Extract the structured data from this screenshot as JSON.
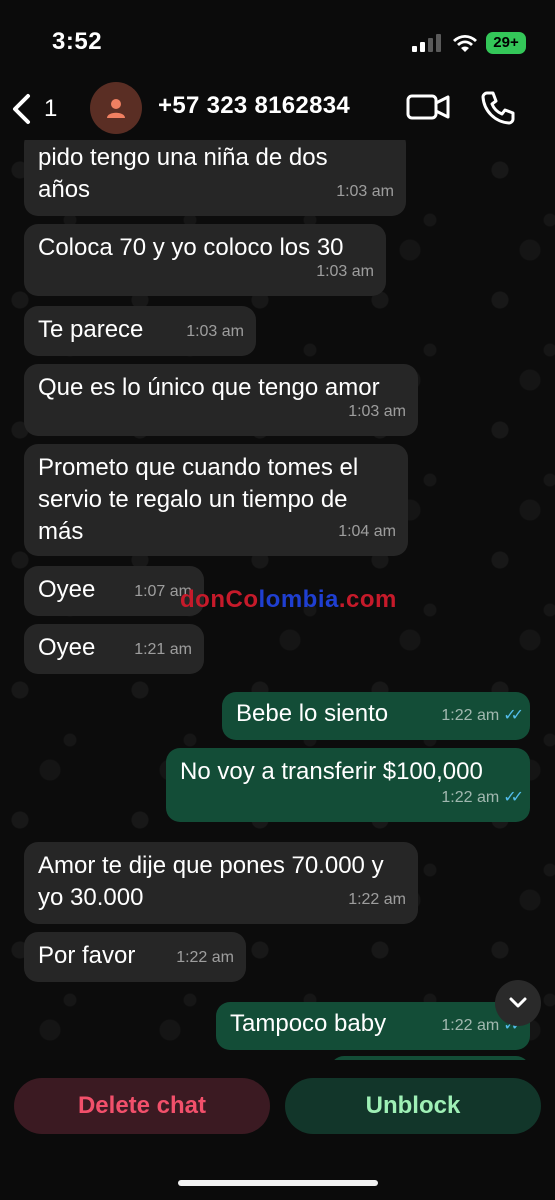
{
  "status_bar": {
    "time": "3:52",
    "battery": "29+"
  },
  "header": {
    "back_count": "1",
    "contact": "+57 323 8162834"
  },
  "messages": [
    {
      "text": "pido tengo una niña de dos años",
      "time": "1:03 am"
    },
    {
      "text": "Coloca 70 y yo coloco los 30",
      "time": "1:03 am"
    },
    {
      "text": "Te parece",
      "time": "1:03 am"
    },
    {
      "text": "Que es lo único que tengo amor",
      "time": "1:03 am"
    },
    {
      "text": "Prometo que cuando tomes el servio te regalo un tiempo de más",
      "time": "1:04 am"
    },
    {
      "text": "Oyee",
      "time": "1:07 am"
    },
    {
      "text": "Oyee",
      "time": "1:21 am"
    },
    {
      "text": "Bebe lo siento",
      "time": "1:22 am"
    },
    {
      "text": "No voy a transferir $100,000",
      "time": "1:22 am"
    },
    {
      "text": "Amor te dije que pones 70.000 y yo 30.000",
      "time": "1:22 am"
    },
    {
      "text": "Por favor",
      "time": "1:22 am"
    },
    {
      "text": "Tampoco baby",
      "time": "1:22 am"
    }
  ],
  "watermark": {
    "part1": "donCo",
    "part2": "lombia",
    "part3": ".com"
  },
  "actions": {
    "delete": "Delete chat",
    "unblock": "Unblock"
  },
  "colors": {
    "incoming": "#262626",
    "outgoing": "#134d37",
    "delete_text": "#f2506b",
    "unblock_text": "#9ff0b6",
    "read_ticks": "#53bdeb"
  },
  "icons": [
    "back-chevron-icon",
    "person-icon",
    "video-camera-icon",
    "phone-icon",
    "chevron-down-icon",
    "double-check-icon"
  ]
}
